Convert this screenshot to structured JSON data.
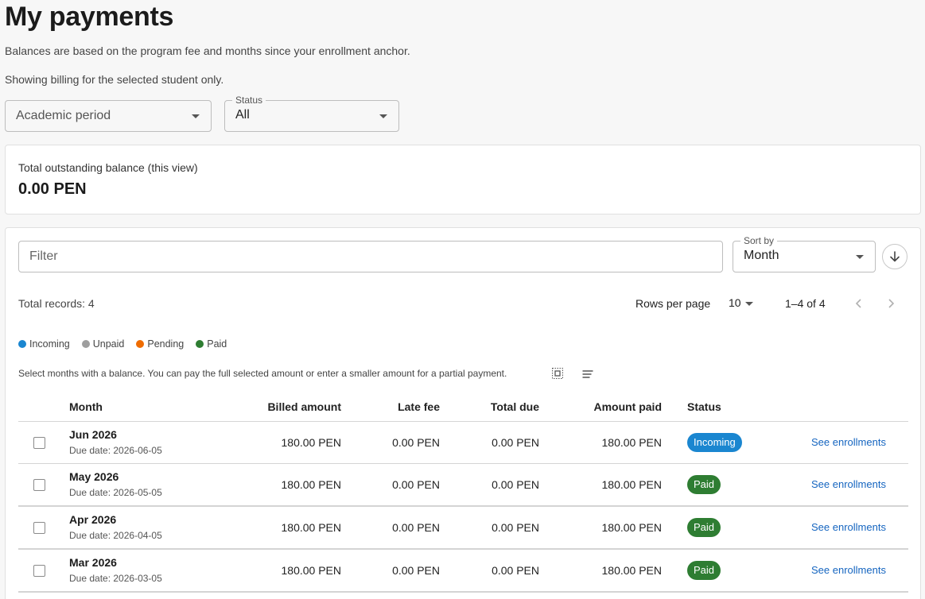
{
  "page": {
    "title": "My payments",
    "subtitle1": "Balances are based on the program fee and months since your enrollment anchor.",
    "subtitle2": "Showing billing for the selected student only."
  },
  "filters": {
    "period": {
      "placeholder": "Academic period"
    },
    "status": {
      "label": "Status",
      "value": "All"
    }
  },
  "balance": {
    "label": "Total outstanding balance (this view)",
    "amount": "0.00 PEN"
  },
  "toolbar": {
    "filter_placeholder": "Filter",
    "sort_label": "Sort by",
    "sort_value": "Month",
    "sort_direction_icon": "arrow-down-icon"
  },
  "pagination": {
    "total_records": "Total records: 4",
    "rows_per_page_label": "Rows per page",
    "rows_per_page": "10",
    "range": "1–4 of 4"
  },
  "legend": [
    {
      "label": "Incoming",
      "color": "#1a86d0"
    },
    {
      "label": "Unpaid",
      "color": "#9e9e9e"
    },
    {
      "label": "Pending",
      "color": "#ef6c00"
    },
    {
      "label": "Paid",
      "color": "#2e7d32"
    }
  ],
  "hint": "Select months with a balance. You can pay the full selected amount or enter a smaller amount for a partial payment.",
  "table": {
    "headers": {
      "month": "Month",
      "billed": "Billed amount",
      "late": "Late fee",
      "total": "Total due",
      "paid": "Amount paid",
      "status": "Status"
    },
    "rows": [
      {
        "month": "Jun 2026",
        "due": "Due date: 2026-06-05",
        "billed": "180.00 PEN",
        "late": "0.00 PEN",
        "total": "0.00 PEN",
        "paid": "180.00 PEN",
        "status": "Incoming",
        "link": "See enrollments"
      },
      {
        "month": "May 2026",
        "due": "Due date: 2026-05-05",
        "billed": "180.00 PEN",
        "late": "0.00 PEN",
        "total": "0.00 PEN",
        "paid": "180.00 PEN",
        "status": "Paid",
        "link": "See enrollments"
      },
      {
        "month": "Apr 2026",
        "due": "Due date: 2026-04-05",
        "billed": "180.00 PEN",
        "late": "0.00 PEN",
        "total": "0.00 PEN",
        "paid": "180.00 PEN",
        "status": "Paid",
        "link": "See enrollments"
      },
      {
        "month": "Mar 2026",
        "due": "Due date: 2026-03-05",
        "billed": "180.00 PEN",
        "late": "0.00 PEN",
        "total": "0.00 PEN",
        "paid": "180.00 PEN",
        "status": "Paid",
        "link": "See enrollments"
      }
    ]
  }
}
